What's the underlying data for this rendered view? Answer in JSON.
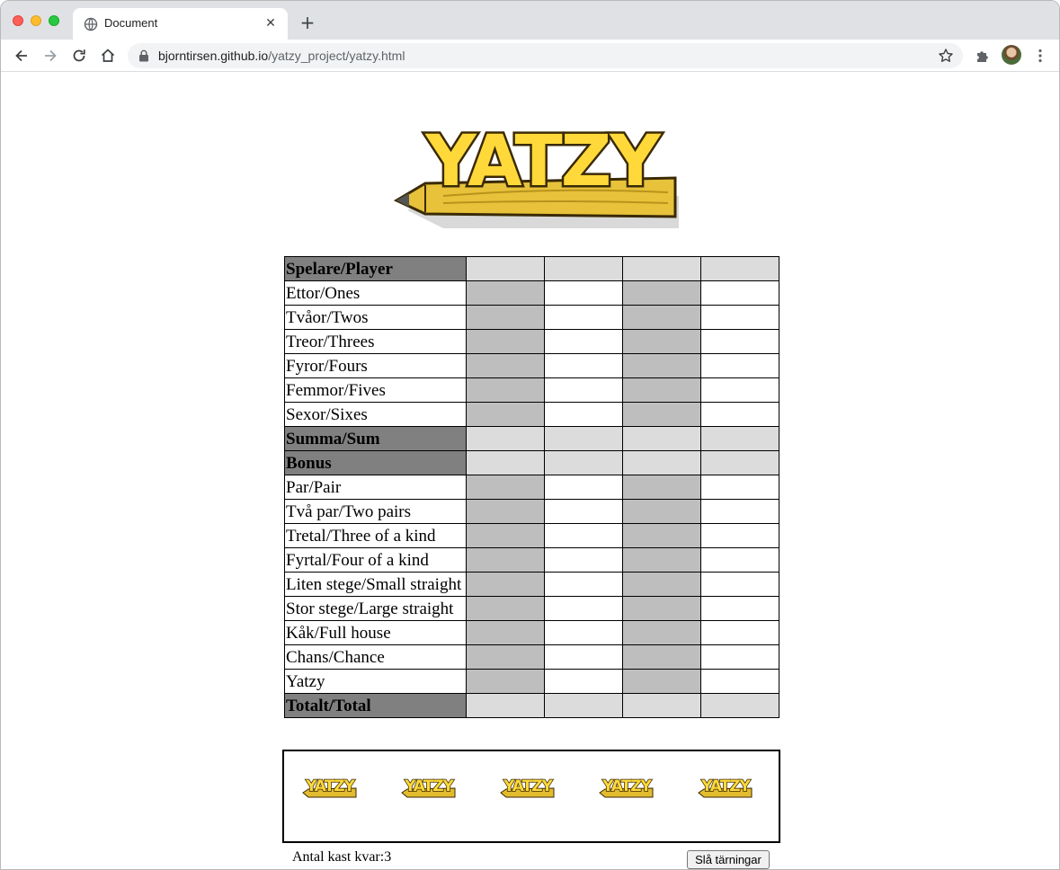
{
  "browser": {
    "tab_title": "Document",
    "tab_close": "✕",
    "new_tab": "+",
    "url_host": "bjorntirsen.github.io",
    "url_path": "/yatzy_project/yatzy.html"
  },
  "logo": {
    "text": "YATZY",
    "colors": {
      "fill": "#ffd93a",
      "outline": "#3a2a05",
      "pencil": "#e8c33a"
    }
  },
  "scorecard": {
    "colors": {
      "header": "#808080",
      "dark_cell": "#bebebe",
      "light_cell": "#dcdcdc"
    },
    "rows": [
      {
        "label": "Spelare/Player",
        "kind": "head"
      },
      {
        "label": "Ettor/Ones",
        "kind": "score"
      },
      {
        "label": "Tvåor/Twos",
        "kind": "score"
      },
      {
        "label": "Treor/Threes",
        "kind": "score"
      },
      {
        "label": "Fyror/Fours",
        "kind": "score"
      },
      {
        "label": "Femmor/Fives",
        "kind": "score"
      },
      {
        "label": "Sexor/Sixes",
        "kind": "score"
      },
      {
        "label": "Summa/Sum",
        "kind": "head"
      },
      {
        "label": "Bonus",
        "kind": "head"
      },
      {
        "label": "Par/Pair",
        "kind": "score"
      },
      {
        "label": "Två par/Two pairs",
        "kind": "score"
      },
      {
        "label": "Tretal/Three of a kind",
        "kind": "score"
      },
      {
        "label": "Fyrtal/Four of a kind",
        "kind": "score"
      },
      {
        "label": "Liten stege/Small straight",
        "kind": "score"
      },
      {
        "label": "Stor stege/Large straight",
        "kind": "score"
      },
      {
        "label": "Kåk/Full house",
        "kind": "score"
      },
      {
        "label": "Chans/Chance",
        "kind": "score"
      },
      {
        "label": "Yatzy",
        "kind": "score"
      },
      {
        "label": "Totalt/Total",
        "kind": "head"
      }
    ]
  },
  "dice": {
    "die_image_text": "YATZY"
  },
  "controls": {
    "rolls_left": "Antal kast kvar:3",
    "roll_button": "Slå tärningar"
  }
}
